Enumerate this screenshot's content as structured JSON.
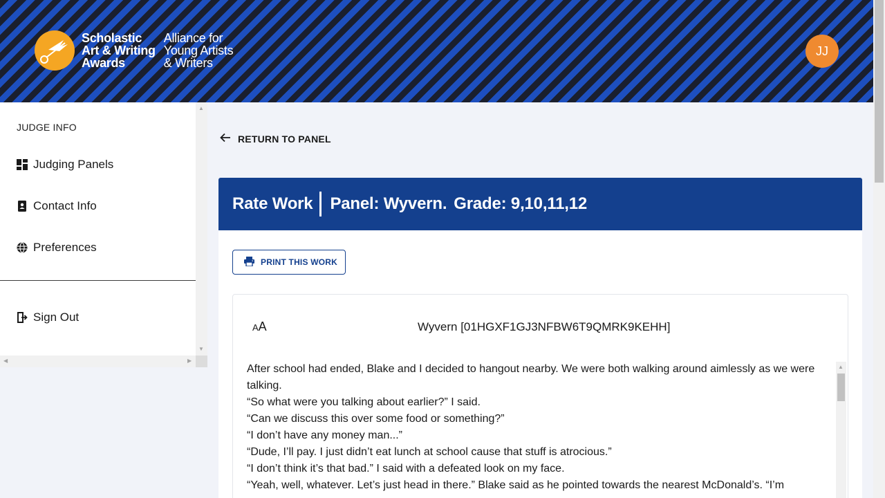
{
  "header": {
    "logo_line1": "Scholastic",
    "logo_line2": "Art & Writing",
    "logo_line3": "Awards",
    "logo_sub1": "Alliance for",
    "logo_sub2": "Young Artists",
    "logo_sub3": "& Writers",
    "avatar_initials": "JJ"
  },
  "sidebar": {
    "section_title": "JUDGE INFO",
    "items": [
      {
        "label": "Judging Panels",
        "icon": "dashboard-icon"
      },
      {
        "label": "Contact Info",
        "icon": "contact-book-icon"
      },
      {
        "label": "Preferences",
        "icon": "globe-icon"
      }
    ],
    "sign_out": {
      "label": "Sign Out",
      "icon": "sign-out-icon"
    }
  },
  "main": {
    "return_label": "RETURN TO PANEL",
    "card_title": "Rate Work",
    "panel_label": "Panel: Wyvern.",
    "grade_label": "Grade: 9,10,11,12",
    "print_label": "PRINT THIS WORK",
    "font_size_small": "A",
    "font_size_large": "A",
    "work_title": "Wyvern [01HGXF1GJ3NFBW6T9QMRK9KEHH]",
    "work_paragraphs": [
      "After school had ended, Blake and I decided to hangout nearby. We were both walking around aimlessly as we were talking.",
      "“So what were you talking about earlier?” I said.",
      "“Can we discuss this over some food or something?”",
      "“I don’t have any money man...”",
      "“Dude, I’ll pay. I just didn’t eat lunch at school cause that stuff is atrocious.”",
      "“I don’t think it’s that bad.” I said with a defeated look on my face.",
      "“Yeah, well, whatever. Let’s just head in there.” Blake said as he pointed towards the nearest McDonald’s. “I’m"
    ]
  },
  "colors": {
    "header_stripe_dark": "#1a1f2e",
    "header_stripe_blue": "#1d4fbf",
    "logo_orange": "#f5a623",
    "avatar_orange": "#ef8a30",
    "card_header_blue": "#14408e"
  }
}
